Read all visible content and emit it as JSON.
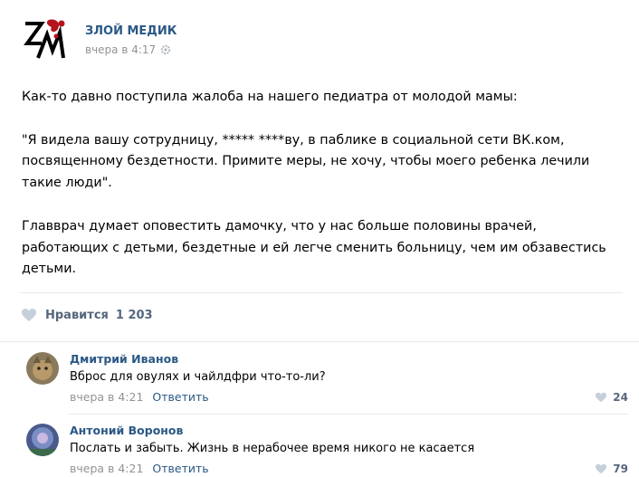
{
  "post": {
    "author": "ЗЛОЙ МЕДИК",
    "time": "вчера в 4:17",
    "paragraphs": [
      "Как-то давно поступила жалоба на нашего педиатра от молодой мамы:",
      "\"Я видела вашу сотрудницу, ***** ****ву, в паблике в социальной сети ВК.ком, посвященному бездетности. Примите меры, не хочу, чтобы моего ребенка лечили такие люди\".",
      "Главврач думает оповестить дамочку, что у нас больше половины врачей, работающих с детьми, бездетные и ей легче сменить больницу, чем им обзавестись детьми."
    ],
    "likes_label": "Нравится",
    "likes_count": "1 203"
  },
  "comments": [
    {
      "name": "Дмитрий Иванов",
      "text": "Вброс для овулях и чайлдфри что-то-ли?",
      "time": "вчера в 4:21",
      "reply": "Ответить",
      "likes": "24"
    },
    {
      "name": "Антоний Воронов",
      "text": "Послать и забыть. Жизнь в нерабочее время никого не касается",
      "time": "вчера в 4:21",
      "reply": "Ответить",
      "likes": "79"
    }
  ],
  "colors": {
    "link": "#2a5885",
    "meta": "#939393",
    "like": "#55677d",
    "divider": "#e7e8ec",
    "heart": "#c5d0db",
    "logo_red": "#b5121b"
  }
}
